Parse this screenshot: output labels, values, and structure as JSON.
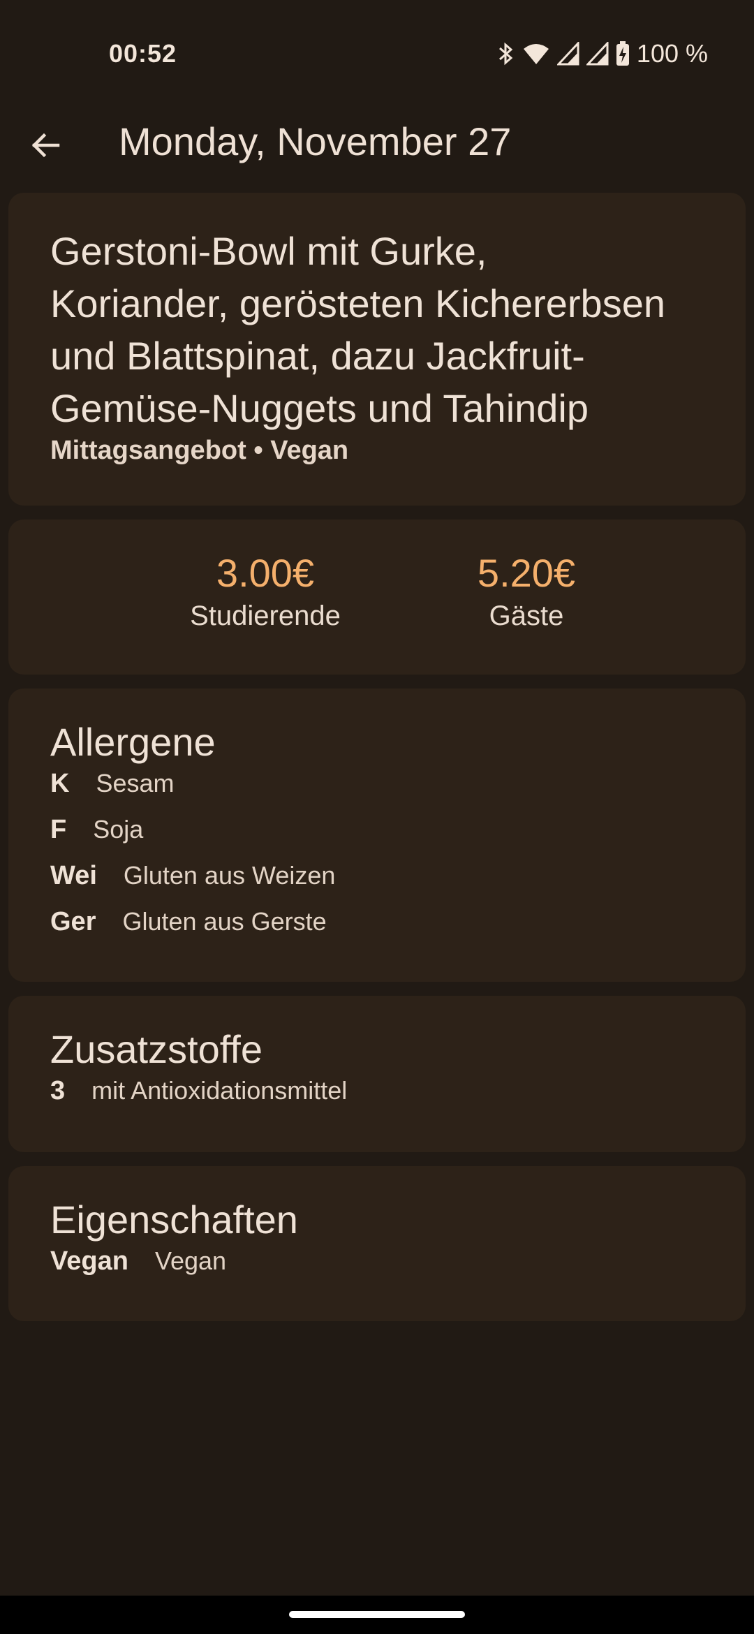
{
  "status_bar": {
    "time": "00:52",
    "battery": "100 %",
    "icons": [
      "bluetooth-icon",
      "wifi-icon",
      "signal-icon",
      "signal-icon",
      "battery-charging-icon"
    ]
  },
  "app_bar": {
    "back_icon": "arrow-back-icon",
    "title": "Monday, November 27"
  },
  "dish": {
    "name_lines": [
      "Gerstoni-Bowl mit Gurke,",
      "Koriander, gerösteten Kichererbsen",
      "und Blattspinat, dazu Jackfruit-",
      "Gemüse-Nuggets und Tahindip"
    ],
    "meta": "Mittagsangebot • Vegan"
  },
  "prices": [
    {
      "value": "3.00€",
      "label": "Studierende"
    },
    {
      "value": "5.20€",
      "label": "Gäste"
    }
  ],
  "allergens": {
    "title": "Allergene",
    "items": [
      {
        "code": "K",
        "text": "Sesam"
      },
      {
        "code": "F",
        "text": "Soja"
      },
      {
        "code": "Wei",
        "text": "Gluten aus Weizen"
      },
      {
        "code": "Ger",
        "text": "Gluten aus Gerste"
      }
    ]
  },
  "additives": {
    "title": "Zusatzstoffe",
    "items": [
      {
        "code": "3",
        "text": "mit Antioxidationsmittel"
      }
    ]
  },
  "properties": {
    "title": "Eigenschaften",
    "items": [
      {
        "code": "Vegan",
        "text": "Vegan"
      }
    ]
  },
  "colors": {
    "background": "#211a14",
    "card": "#2d2218",
    "price_accent": "#f5b06c",
    "text": "#ede0d4"
  }
}
